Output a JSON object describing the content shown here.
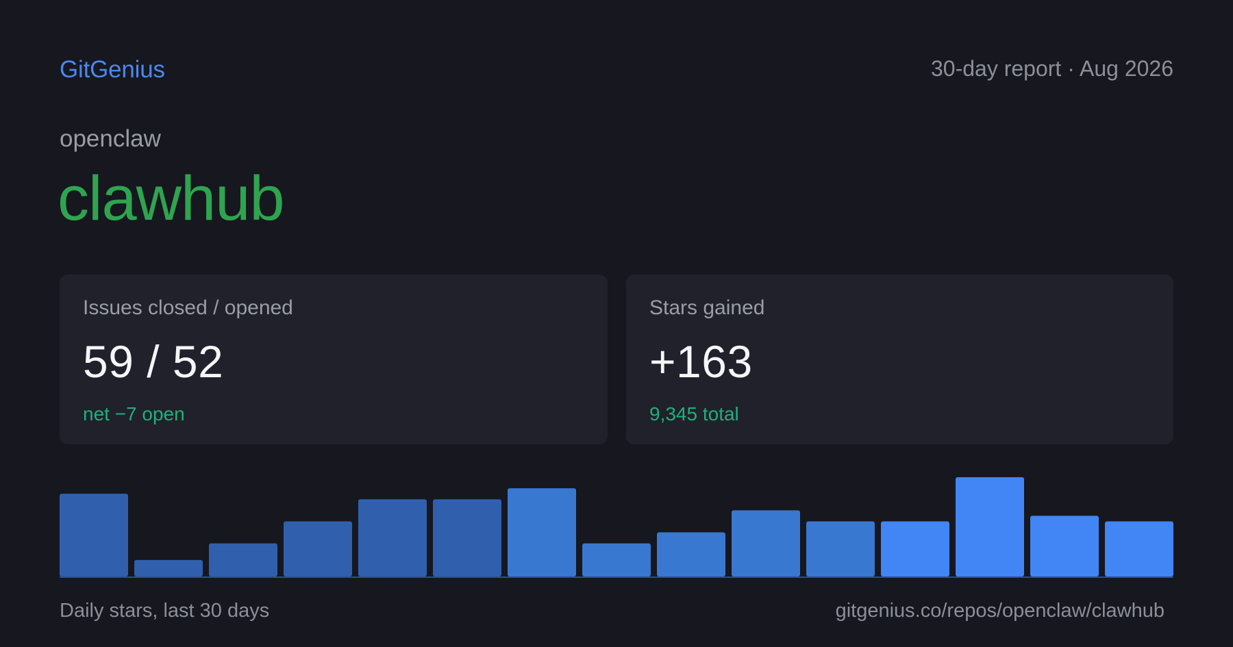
{
  "header": {
    "brand": "GitGenius",
    "report_label": "30-day report · Aug 2026"
  },
  "repo": {
    "owner": "openclaw",
    "name": "clawhub"
  },
  "cards": {
    "issues": {
      "label": "Issues closed / opened",
      "value": "59 / 52",
      "sub": "net −7 open"
    },
    "stars": {
      "label": "Stars gained",
      "value": "+163",
      "sub": "9,345 total"
    }
  },
  "footer": {
    "caption": "Daily stars, last 30 days",
    "url": "gitgenius.co/repos/openclaw/clawhub"
  },
  "colors": {
    "brand": "#4b87f0",
    "repo_name": "#2fa44f",
    "positive": "#20b07a",
    "bar_dark": "#3060ad",
    "bar_mid": "#3878d0",
    "bar_bright": "#4285f4"
  },
  "chart_data": {
    "type": "bar",
    "title": "",
    "xlabel": "",
    "ylabel": "",
    "values": [
      15,
      3,
      6,
      10,
      14,
      14,
      16,
      6,
      8,
      12,
      10,
      10,
      18,
      11,
      10
    ],
    "bar_colors": [
      "#3060ad",
      "#3060ad",
      "#3060ad",
      "#3060ad",
      "#3060ad",
      "#3060ad",
      "#3878d0",
      "#3878d0",
      "#3878d0",
      "#3878d0",
      "#3878d0",
      "#4285f4",
      "#4285f4",
      "#4285f4",
      "#4285f4"
    ],
    "ylim": [
      0,
      18
    ],
    "grid": false,
    "legend": false
  }
}
